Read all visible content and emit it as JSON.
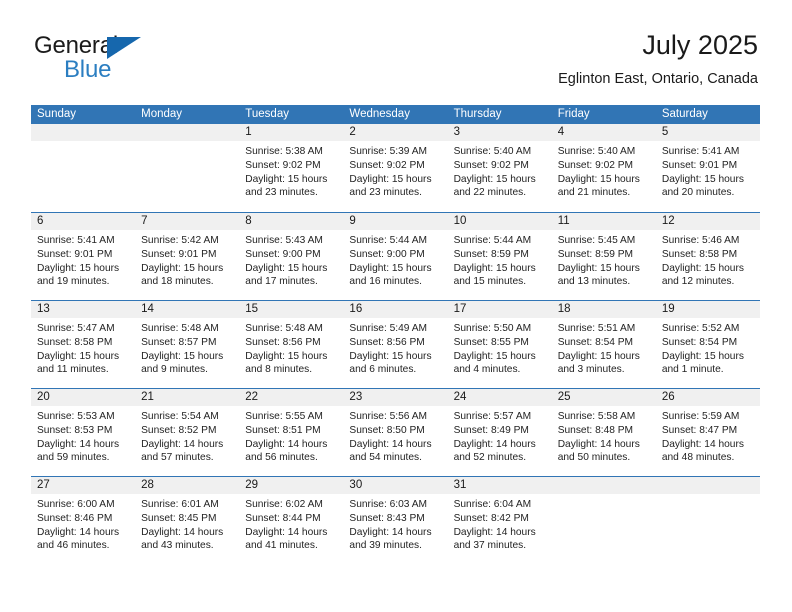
{
  "brand": {
    "name_primary": "General",
    "name_secondary": "Blue",
    "triangle_icon": "triangle-icon",
    "accent_color": "#1667ad",
    "secondary_color": "#2b7ec1"
  },
  "header": {
    "title": "July 2025",
    "subtitle": "Eglinton East, Ontario, Canada"
  },
  "calendar": {
    "header_bg": "#3175b5",
    "daynum_bg": "#f0f0f0",
    "weekdays": [
      "Sunday",
      "Monday",
      "Tuesday",
      "Wednesday",
      "Thursday",
      "Friday",
      "Saturday"
    ],
    "weeks": [
      [
        {
          "day": "",
          "lines": []
        },
        {
          "day": "",
          "lines": []
        },
        {
          "day": "1",
          "lines": [
            "Sunrise: 5:38 AM",
            "Sunset: 9:02 PM",
            "Daylight: 15 hours",
            "and 23 minutes."
          ]
        },
        {
          "day": "2",
          "lines": [
            "Sunrise: 5:39 AM",
            "Sunset: 9:02 PM",
            "Daylight: 15 hours",
            "and 23 minutes."
          ]
        },
        {
          "day": "3",
          "lines": [
            "Sunrise: 5:40 AM",
            "Sunset: 9:02 PM",
            "Daylight: 15 hours",
            "and 22 minutes."
          ]
        },
        {
          "day": "4",
          "lines": [
            "Sunrise: 5:40 AM",
            "Sunset: 9:02 PM",
            "Daylight: 15 hours",
            "and 21 minutes."
          ]
        },
        {
          "day": "5",
          "lines": [
            "Sunrise: 5:41 AM",
            "Sunset: 9:01 PM",
            "Daylight: 15 hours",
            "and 20 minutes."
          ]
        }
      ],
      [
        {
          "day": "6",
          "lines": [
            "Sunrise: 5:41 AM",
            "Sunset: 9:01 PM",
            "Daylight: 15 hours",
            "and 19 minutes."
          ]
        },
        {
          "day": "7",
          "lines": [
            "Sunrise: 5:42 AM",
            "Sunset: 9:01 PM",
            "Daylight: 15 hours",
            "and 18 minutes."
          ]
        },
        {
          "day": "8",
          "lines": [
            "Sunrise: 5:43 AM",
            "Sunset: 9:00 PM",
            "Daylight: 15 hours",
            "and 17 minutes."
          ]
        },
        {
          "day": "9",
          "lines": [
            "Sunrise: 5:44 AM",
            "Sunset: 9:00 PM",
            "Daylight: 15 hours",
            "and 16 minutes."
          ]
        },
        {
          "day": "10",
          "lines": [
            "Sunrise: 5:44 AM",
            "Sunset: 8:59 PM",
            "Daylight: 15 hours",
            "and 15 minutes."
          ]
        },
        {
          "day": "11",
          "lines": [
            "Sunrise: 5:45 AM",
            "Sunset: 8:59 PM",
            "Daylight: 15 hours",
            "and 13 minutes."
          ]
        },
        {
          "day": "12",
          "lines": [
            "Sunrise: 5:46 AM",
            "Sunset: 8:58 PM",
            "Daylight: 15 hours",
            "and 12 minutes."
          ]
        }
      ],
      [
        {
          "day": "13",
          "lines": [
            "Sunrise: 5:47 AM",
            "Sunset: 8:58 PM",
            "Daylight: 15 hours",
            "and 11 minutes."
          ]
        },
        {
          "day": "14",
          "lines": [
            "Sunrise: 5:48 AM",
            "Sunset: 8:57 PM",
            "Daylight: 15 hours",
            "and 9 minutes."
          ]
        },
        {
          "day": "15",
          "lines": [
            "Sunrise: 5:48 AM",
            "Sunset: 8:56 PM",
            "Daylight: 15 hours",
            "and 8 minutes."
          ]
        },
        {
          "day": "16",
          "lines": [
            "Sunrise: 5:49 AM",
            "Sunset: 8:56 PM",
            "Daylight: 15 hours",
            "and 6 minutes."
          ]
        },
        {
          "day": "17",
          "lines": [
            "Sunrise: 5:50 AM",
            "Sunset: 8:55 PM",
            "Daylight: 15 hours",
            "and 4 minutes."
          ]
        },
        {
          "day": "18",
          "lines": [
            "Sunrise: 5:51 AM",
            "Sunset: 8:54 PM",
            "Daylight: 15 hours",
            "and 3 minutes."
          ]
        },
        {
          "day": "19",
          "lines": [
            "Sunrise: 5:52 AM",
            "Sunset: 8:54 PM",
            "Daylight: 15 hours",
            "and 1 minute."
          ]
        }
      ],
      [
        {
          "day": "20",
          "lines": [
            "Sunrise: 5:53 AM",
            "Sunset: 8:53 PM",
            "Daylight: 14 hours",
            "and 59 minutes."
          ]
        },
        {
          "day": "21",
          "lines": [
            "Sunrise: 5:54 AM",
            "Sunset: 8:52 PM",
            "Daylight: 14 hours",
            "and 57 minutes."
          ]
        },
        {
          "day": "22",
          "lines": [
            "Sunrise: 5:55 AM",
            "Sunset: 8:51 PM",
            "Daylight: 14 hours",
            "and 56 minutes."
          ]
        },
        {
          "day": "23",
          "lines": [
            "Sunrise: 5:56 AM",
            "Sunset: 8:50 PM",
            "Daylight: 14 hours",
            "and 54 minutes."
          ]
        },
        {
          "day": "24",
          "lines": [
            "Sunrise: 5:57 AM",
            "Sunset: 8:49 PM",
            "Daylight: 14 hours",
            "and 52 minutes."
          ]
        },
        {
          "day": "25",
          "lines": [
            "Sunrise: 5:58 AM",
            "Sunset: 8:48 PM",
            "Daylight: 14 hours",
            "and 50 minutes."
          ]
        },
        {
          "day": "26",
          "lines": [
            "Sunrise: 5:59 AM",
            "Sunset: 8:47 PM",
            "Daylight: 14 hours",
            "and 48 minutes."
          ]
        }
      ],
      [
        {
          "day": "27",
          "lines": [
            "Sunrise: 6:00 AM",
            "Sunset: 8:46 PM",
            "Daylight: 14 hours",
            "and 46 minutes."
          ]
        },
        {
          "day": "28",
          "lines": [
            "Sunrise: 6:01 AM",
            "Sunset: 8:45 PM",
            "Daylight: 14 hours",
            "and 43 minutes."
          ]
        },
        {
          "day": "29",
          "lines": [
            "Sunrise: 6:02 AM",
            "Sunset: 8:44 PM",
            "Daylight: 14 hours",
            "and 41 minutes."
          ]
        },
        {
          "day": "30",
          "lines": [
            "Sunrise: 6:03 AM",
            "Sunset: 8:43 PM",
            "Daylight: 14 hours",
            "and 39 minutes."
          ]
        },
        {
          "day": "31",
          "lines": [
            "Sunrise: 6:04 AM",
            "Sunset: 8:42 PM",
            "Daylight: 14 hours",
            "and 37 minutes."
          ]
        },
        {
          "day": "",
          "lines": []
        },
        {
          "day": "",
          "lines": []
        }
      ]
    ]
  }
}
